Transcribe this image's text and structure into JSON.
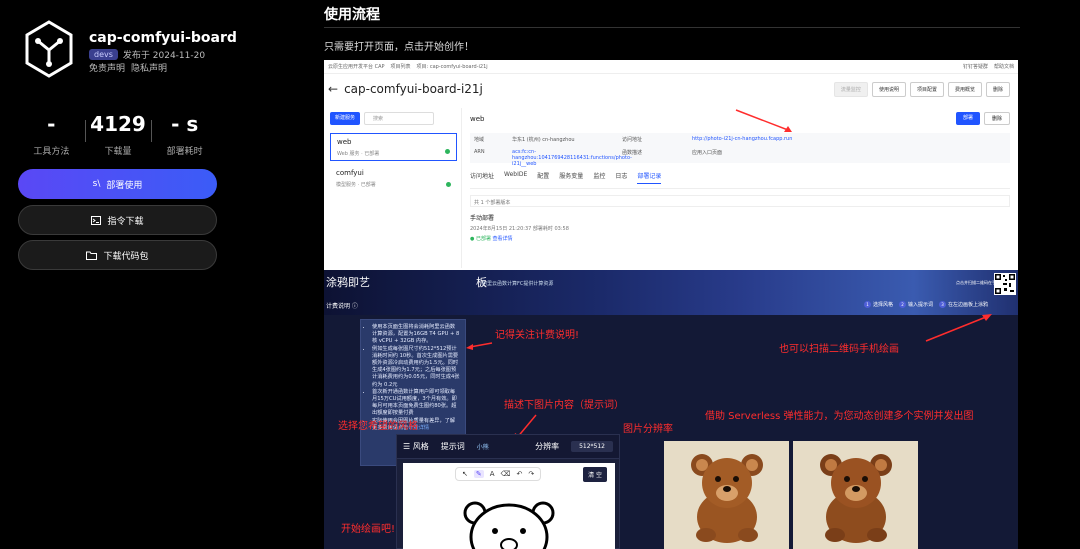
{
  "app": {
    "name": "cap-comfyui-board",
    "badge": "devs",
    "published": "发布于  2024-11-20",
    "disclaimer": "免责声明",
    "privacy": "隐私声明"
  },
  "stats": [
    {
      "value": "-",
      "label": "工具方法"
    },
    {
      "value": "4129",
      "label": "下载量"
    },
    {
      "value": "- s",
      "label": "部署耗时"
    }
  ],
  "buttons": {
    "deploy": "部署使用",
    "deploy_icon": "s\\",
    "cli": "指令下载",
    "code": "下载代码包"
  },
  "content": {
    "title": "使用流程",
    "intro": "只需要打开页面，点击开始创作！"
  },
  "console": {
    "topbar_left": [
      "云原生应用开发平台 CAP",
      "项目列表",
      "项目: cap-comfyui-board-i21j"
    ],
    "topbar_right": [
      "钉钉答疑群",
      "帮助文档"
    ],
    "title": "cap-comfyui-board-i21j",
    "actions": [
      "流量监控",
      "使用说明",
      "项目配置",
      "费用概览",
      "删除"
    ],
    "new_service": "新建服务",
    "search_placeholder": "搜索",
    "services": [
      {
        "name": "web",
        "sub": "Web 服务 · 已部署"
      },
      {
        "name": "comfyui",
        "sub": "模型服务 · 已部署"
      }
    ],
    "detail_name": "web",
    "deploy_btn": "部署",
    "delete_btn": "删除",
    "info": {
      "region_label": "地域",
      "region_value": "华东1 (杭州)   cn-hangzhou",
      "access_label": "访问地址",
      "access_value": "http://photo-i21j-cn-hangzhou.fcapp.run",
      "arn_label": "ARN",
      "arn_value": "acs:fc:cn-hangzhou:1041769428116431:functions/photo-i21j__web",
      "desc_label": "函数描述",
      "desc_value": "应用入口页面"
    },
    "tabs": [
      "访问地址",
      "WebIDE",
      "配置",
      "服务变量",
      "监控",
      "日志",
      "部署记录"
    ],
    "records_count": "共 1 个部署版本",
    "record_title": "手动部署",
    "record_time": "2024年8月15日 21:20:37    部署耗时 03:58",
    "record_status": "● 已部署",
    "record_link": "查看详情"
  },
  "app_shot": {
    "heading": "涂鸦即艺",
    "heading_right": "板",
    "banner_tip": "阿里云函数计算FC提供计算资源",
    "qr_tip": "点击并扫描二维码在手机上使用",
    "billing": "计费说明 ⓘ",
    "steps": [
      {
        "num": "1",
        "label": "选择风格"
      },
      {
        "num": "2",
        "label": "输入提示词"
      },
      {
        "num": "3",
        "label": "在左边画板上涂鸦"
      }
    ],
    "tooltip": [
      "使用本页面生图将会消耗阿里云函数计算资源，配置为16GB T4 GPU + 8核 vCPU + 32GB 内存。",
      "例如生成每张图尺寸约512*512预计消耗时间约 10秒。首次生成图片需要额外资源冷启动费用约为1.5元。同时生成4张图约为1.7元；之后每张图预计消耗费用约为0.05元，同时生成4张约为 0.2元",
      "首次新开通函数计算用户即可领取每月15万CU试用额度，3个月有效。即每月可用本页面免费生图约80张。超出额度即按量付费",
      "实际使用会因图片质量有差异，了解更多费用请点击"
    ],
    "tooltip_link": "计费详情",
    "annotations": {
      "billing_note": "记得关注计费说明!",
      "qr_note": "也可以扫描二维码手机绘画",
      "prompt_note": "描述下图片内容（提示词）",
      "style_note": "选择您希望的风格",
      "res_note": "图片分辨率",
      "serverless_note": "借助 Serverless 弹性能力，为您动态创建多个实例并发出图",
      "start_note": "开始绘画吧!"
    },
    "editor": {
      "style_label": "风格",
      "prompt_label": "提示词",
      "prompt_value": "小熊",
      "res_label": "分辨率",
      "res_value": "512*512",
      "clear": "清 空",
      "tools": [
        "↖",
        "✎",
        "A",
        "⌫",
        "↶",
        "↷"
      ]
    }
  },
  "colors": {
    "primary": "#4b52f6",
    "annotation": "#ff2d2d",
    "link": "#2155ff"
  }
}
